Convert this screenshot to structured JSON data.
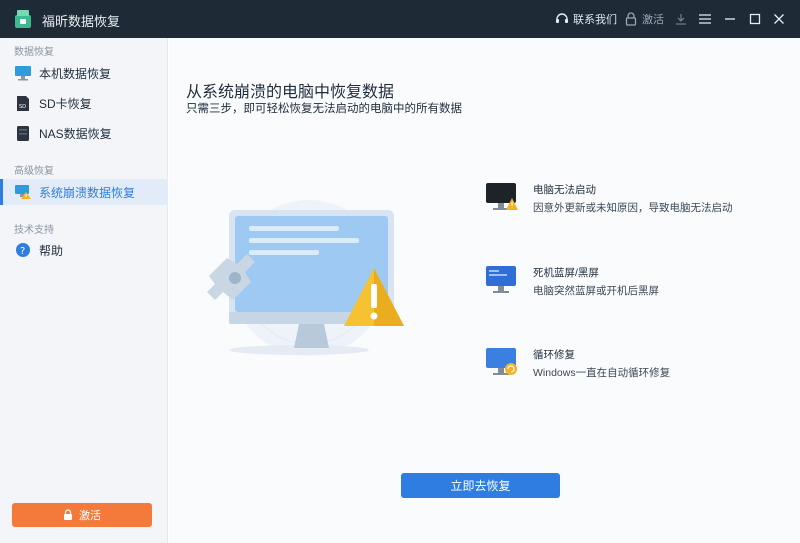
{
  "app": {
    "title": "福昕数据恢复"
  },
  "titlebar": {
    "contact_label": "联系我们",
    "activate_label": "激活"
  },
  "sidebar": {
    "sections": [
      "数据恢复",
      "高级恢复",
      "技术支持"
    ],
    "items": [
      {
        "label": "本机数据恢复",
        "icon": "monitor-icon"
      },
      {
        "label": "SD卡恢复",
        "icon": "sd-card-icon"
      },
      {
        "label": "NAS数据恢复",
        "icon": "nas-icon"
      },
      {
        "label": "系统崩溃数据恢复",
        "icon": "crash-monitor-icon",
        "active": true
      },
      {
        "label": "帮助",
        "icon": "help-icon"
      }
    ],
    "activate_button": "激活"
  },
  "main": {
    "title": "从系统崩溃的电脑中恢复数据",
    "subtitle": "只需三步，即可轻松恢复无法启动的电脑中的所有数据",
    "features": [
      {
        "title": "电脑无法启动",
        "desc": "因意外更新或未知原因，导致电脑无法启动",
        "icon": "black-monitor-warning-icon"
      },
      {
        "title": "死机蓝屏/黑屏",
        "desc": "电脑突然蓝屏或开机后黑屏",
        "icon": "blue-screen-icon"
      },
      {
        "title": "循环修复",
        "desc": "Windows一直在自动循环修复",
        "icon": "repair-loop-icon"
      }
    ],
    "recover_button": "立即去恢复"
  },
  "colors": {
    "accent": "#2f7de1",
    "activate": "#f47a3c",
    "titlebar": "#1e2a36"
  }
}
